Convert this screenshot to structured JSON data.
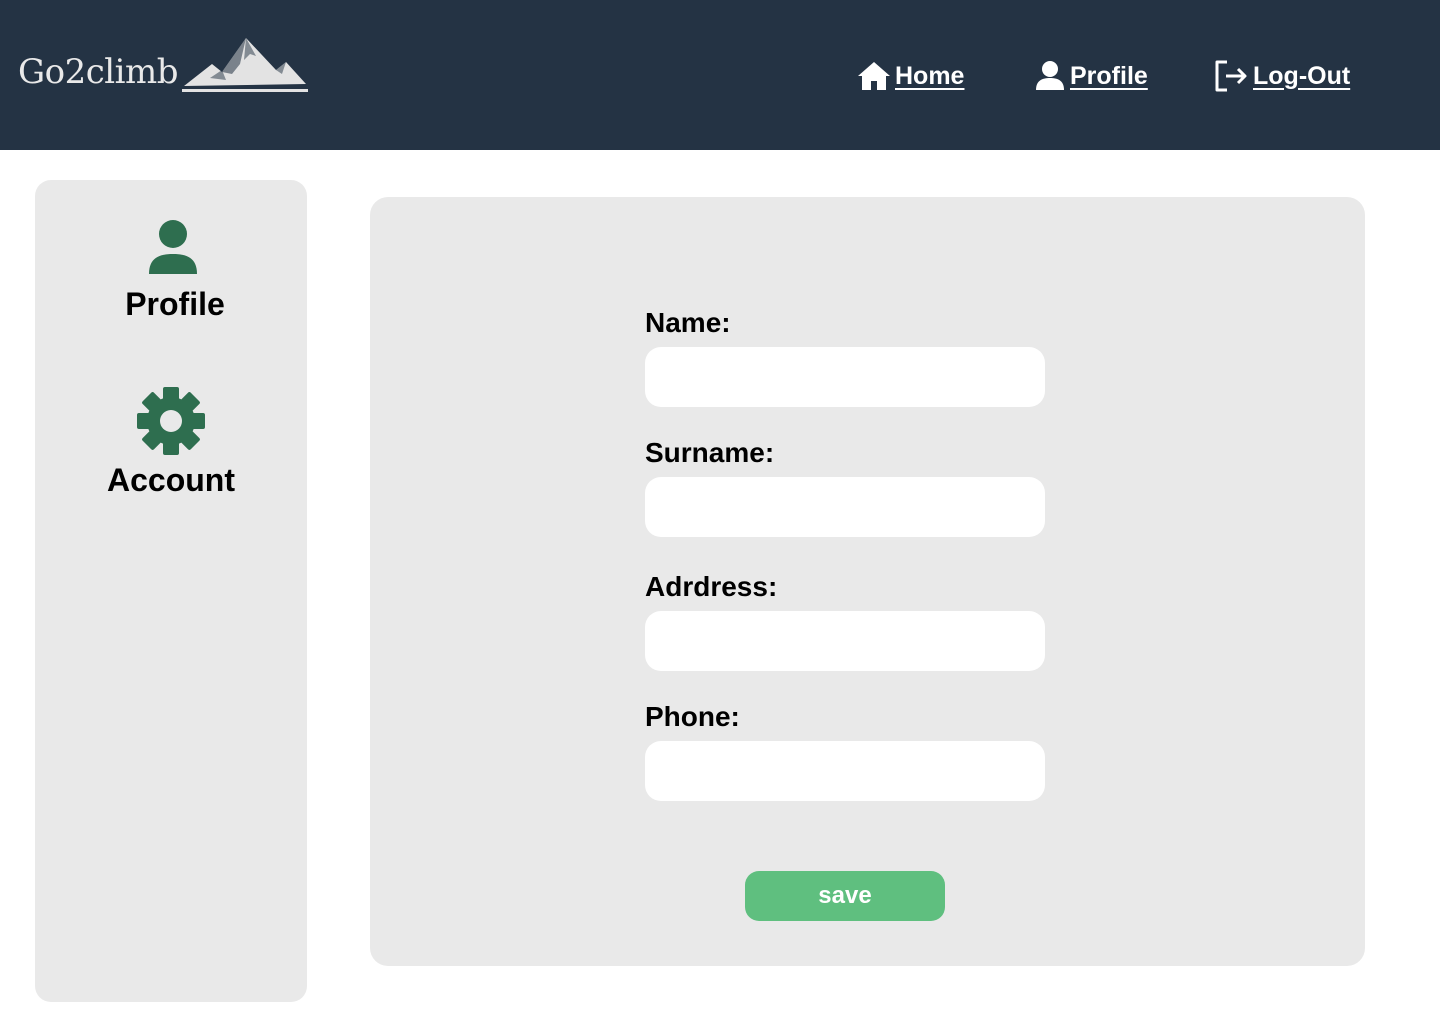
{
  "header": {
    "logo_text": "Go2climb",
    "nav": {
      "home_label": "Home",
      "profile_label": "Profile",
      "logout_label": "Log-Out"
    }
  },
  "sidebar": {
    "items": [
      {
        "label": "Profile",
        "icon": "user-icon"
      },
      {
        "label": "Account",
        "icon": "gear-icon"
      }
    ]
  },
  "form": {
    "fields": [
      {
        "label": "Name:",
        "value": ""
      },
      {
        "label": "Surname:",
        "value": ""
      },
      {
        "label": "Adrdress:",
        "value": ""
      },
      {
        "label": "Phone:",
        "value": ""
      }
    ],
    "save_label": "save"
  },
  "colors": {
    "header_bg": "#243344",
    "panel_bg": "#e9e9e9",
    "icon_green": "#2e6e4f",
    "save_green": "#5fbf7f"
  }
}
